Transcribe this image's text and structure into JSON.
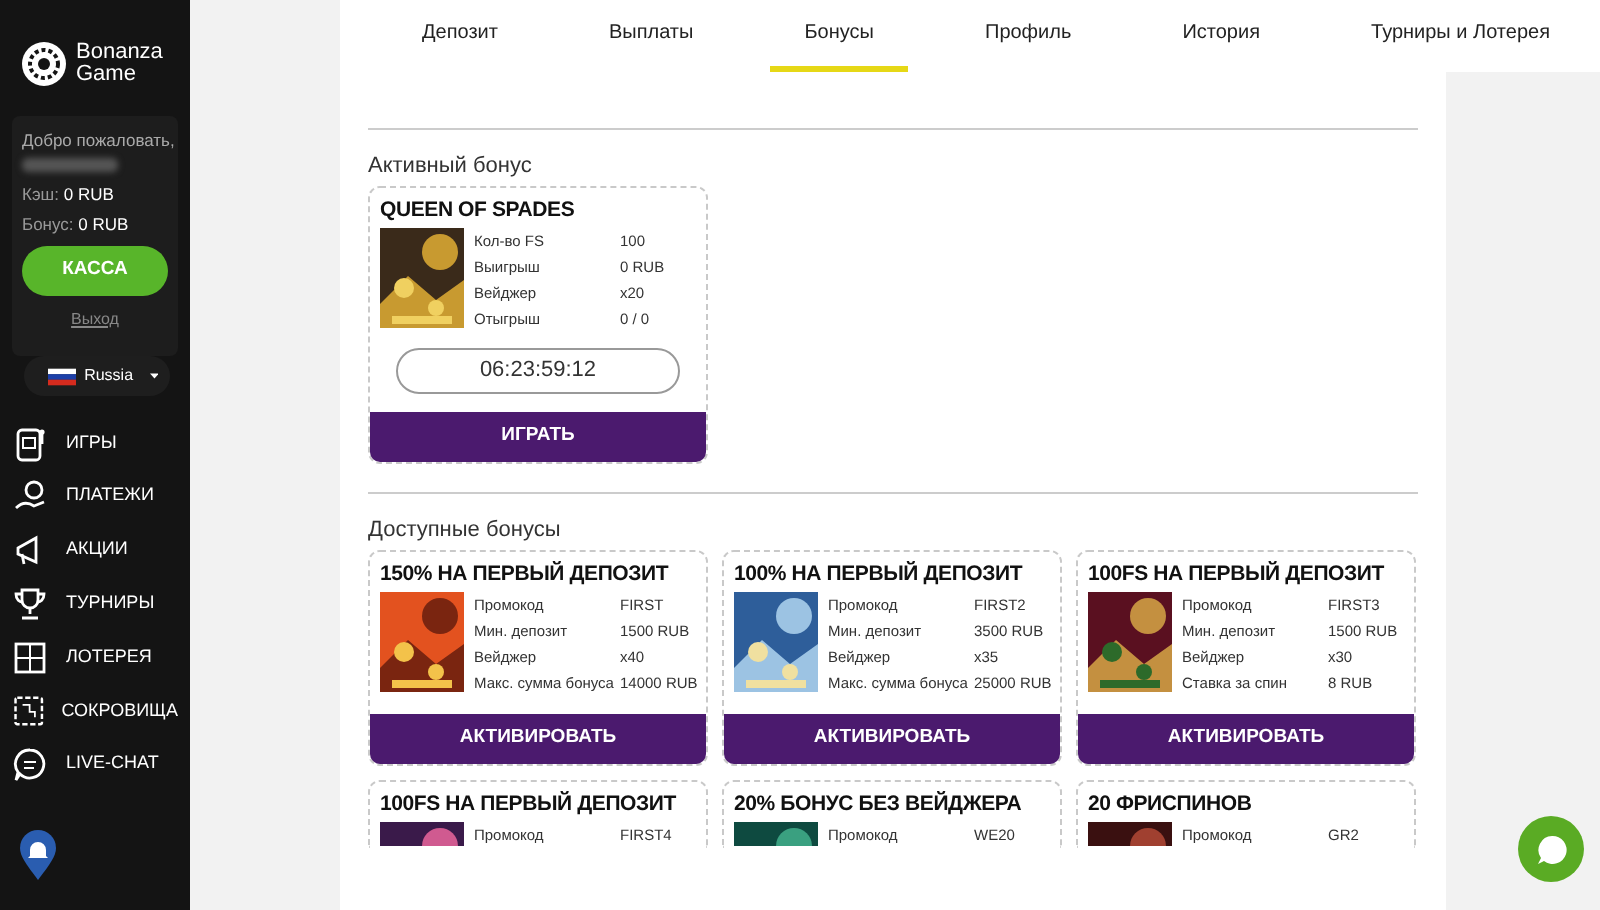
{
  "sidebar": {
    "logo": {
      "line_1": "Bonanza",
      "line_2": "Game"
    },
    "user": {
      "welcome": "Добро пожаловать,",
      "cash_label": "Кэш:",
      "cash_value": "0 RUB",
      "bonus_label": "Бонус:",
      "bonus_value": "0 RUB",
      "cashier_button": "КАССА",
      "logout": "Выход",
      "language": "Russia"
    },
    "menu": [
      {
        "label": "ИГРЫ"
      },
      {
        "label": "ПЛАТЕЖИ"
      },
      {
        "label": "АКЦИИ"
      },
      {
        "label": "ТУРНИРЫ"
      },
      {
        "label": "ЛОТЕРЕЯ"
      },
      {
        "label": "СОКРОВИЩА"
      },
      {
        "label": "LIVE-CHAT"
      }
    ]
  },
  "tabs": [
    {
      "label": "Депозит",
      "selected": false
    },
    {
      "label": "Выплаты",
      "selected": false
    },
    {
      "label": "Бонусы",
      "selected": true
    },
    {
      "label": "Профиль",
      "selected": false
    },
    {
      "label": "История",
      "selected": false
    },
    {
      "label": "Турниры и Лотерея",
      "selected": false
    }
  ],
  "active_bonus": {
    "heading": "Активный бонус",
    "card": {
      "title": "QUEEN OF SPADES",
      "rows": [
        {
          "label": "Кол-во FS",
          "value": "100"
        },
        {
          "label": "Выигрыш",
          "value": "0 RUB"
        },
        {
          "label": "Вейджер",
          "value": "x20"
        },
        {
          "label": "Отыгрыш",
          "value": "0 / 0"
        }
      ],
      "timer": "06:23:59:12",
      "button": "ИГРАТЬ"
    }
  },
  "available_bonuses": {
    "heading": "Доступные бонусы",
    "cards": [
      {
        "title": "150% НА ПЕРВЫЙ ДЕПОЗИТ",
        "rows": [
          {
            "label": "Промокод",
            "value": "FIRST"
          },
          {
            "label": "Мин. депозит",
            "value": "1500 RUB"
          },
          {
            "label": "Вейджер",
            "value": "x40"
          },
          {
            "label": "Макс. сумма бонуса",
            "value": "14000 RUB"
          }
        ],
        "button": "АКТИВИРОВАТЬ"
      },
      {
        "title": "100% НА ПЕРВЫЙ ДЕПОЗИТ",
        "rows": [
          {
            "label": "Промокод",
            "value": "FIRST2"
          },
          {
            "label": "Мин. депозит",
            "value": "3500 RUB"
          },
          {
            "label": "Вейджер",
            "value": "x35"
          },
          {
            "label": "Макс. сумма бонуса",
            "value": "25000 RUB"
          }
        ],
        "button": "АКТИВИРОВАТЬ"
      },
      {
        "title": "100FS НА ПЕРВЫЙ ДЕПОЗИТ",
        "rows": [
          {
            "label": "Промокод",
            "value": "FIRST3"
          },
          {
            "label": "Мин. депозит",
            "value": "1500 RUB"
          },
          {
            "label": "Вейджер",
            "value": "x30"
          },
          {
            "label": "Ставка за спин",
            "value": "8 RUB"
          }
        ],
        "button": "АКТИВИРОВАТЬ"
      },
      {
        "title": "100FS НА ПЕРВЫЙ ДЕПОЗИТ",
        "rows": [
          {
            "label": "Промокод",
            "value": "FIRST4"
          }
        ]
      },
      {
        "title": "20% БОНУС БЕЗ ВЕЙДЖЕРА",
        "rows": [
          {
            "label": "Промокод",
            "value": "WE20"
          }
        ]
      },
      {
        "title": "20 ФРИСПИНОВ",
        "rows": [
          {
            "label": "Промокод",
            "value": "GR2"
          }
        ]
      }
    ]
  }
}
